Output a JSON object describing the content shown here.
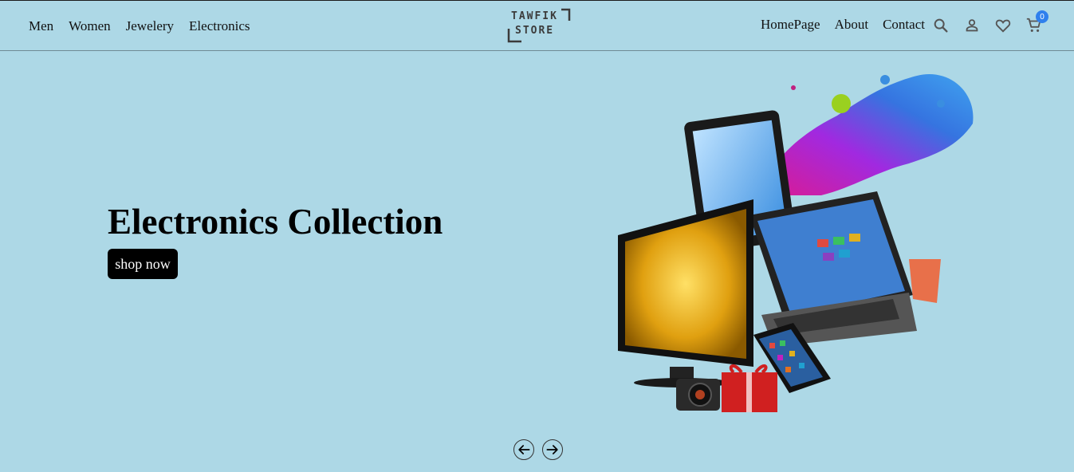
{
  "header": {
    "nav_left": [
      "Men",
      "Women",
      "Jewelery",
      "Electronics"
    ],
    "logo": {
      "line1": "TAWFIK",
      "line2": "STORE"
    },
    "nav_right": [
      "HomePage",
      "About",
      "Contact"
    ],
    "icons": [
      "search-icon",
      "user-icon",
      "heart-icon",
      "cart-icon"
    ],
    "cart_count": "0"
  },
  "hero": {
    "title": "Electronics Collection",
    "button_label": "shop now",
    "image": "electronics-devices"
  },
  "carousel": {
    "prev_icon": "arrow-left-icon",
    "next_icon": "arrow-right-icon"
  },
  "colors": {
    "background": "#add8e6",
    "button": "#000000",
    "badge": "#2f80ed"
  }
}
